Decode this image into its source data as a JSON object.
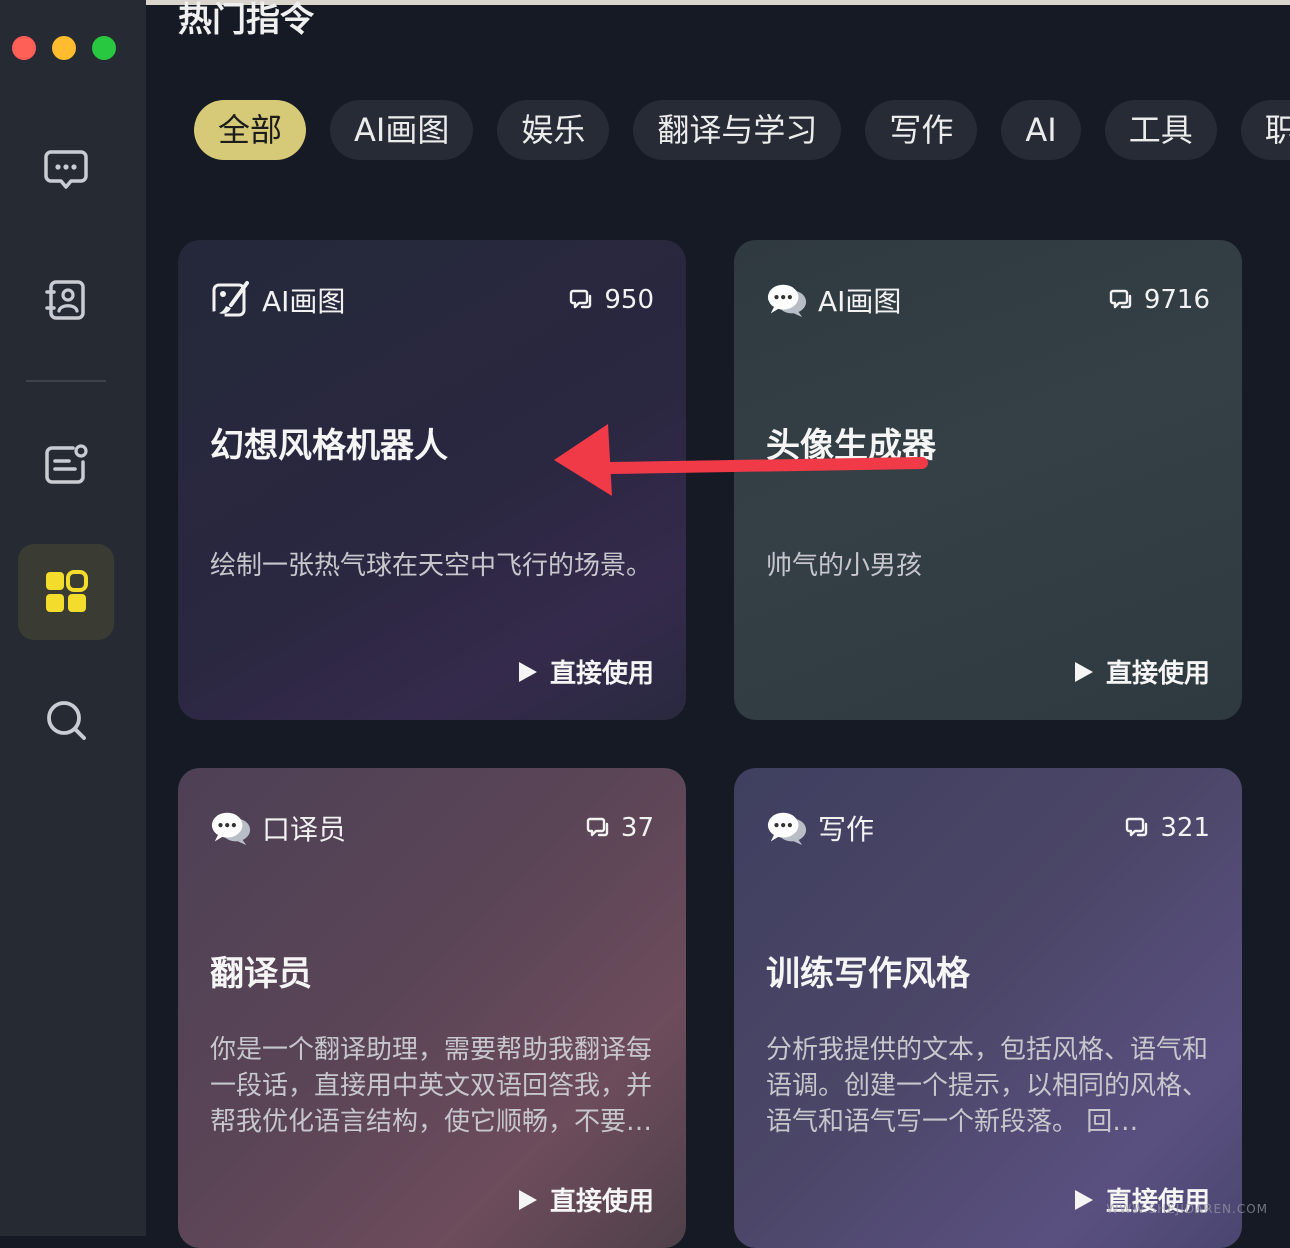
{
  "app": {
    "title": "热门指令",
    "window_controls": [
      "close",
      "minimize",
      "zoom"
    ]
  },
  "sidebar": {
    "items": [
      {
        "id": "chat",
        "icon": "chat-bubble-icon",
        "active": false
      },
      {
        "id": "contacts",
        "icon": "contact-card-icon",
        "active": false
      },
      {
        "id": "notes",
        "icon": "note-edit-icon",
        "active": false
      },
      {
        "id": "apps",
        "icon": "grid-apps-icon",
        "active": true
      },
      {
        "id": "search",
        "icon": "search-icon",
        "active": false
      }
    ]
  },
  "tabs": [
    {
      "label": "全部",
      "active": true
    },
    {
      "label": "AI画图",
      "active": false
    },
    {
      "label": "娱乐",
      "active": false
    },
    {
      "label": "翻译与学习",
      "active": false
    },
    {
      "label": "写作",
      "active": false
    },
    {
      "label": "AI",
      "active": false
    },
    {
      "label": "工具",
      "active": false
    },
    {
      "label": "职",
      "active": false
    }
  ],
  "cards": [
    {
      "category": "AI画图",
      "category_icon": "paint-brush-icon",
      "count": "950",
      "title": "幻想风格机器人",
      "description": "绘制一张热气球在天空中飞行的场景。",
      "action": "直接使用"
    },
    {
      "category": "AI画图",
      "category_icon": "chat-bubbles-icon",
      "count": "9716",
      "title": "头像生成器",
      "description": "帅气的小男孩",
      "action": "直接使用"
    },
    {
      "category": "口译员",
      "category_icon": "chat-bubbles-icon",
      "count": "37",
      "title": "翻译员",
      "description": "你是一个翻译助理，需要帮助我翻译每一段话，直接用中英文双语回答我，并帮我优化语言结构，使它顺畅，不要…",
      "action": "直接使用"
    },
    {
      "category": "写作",
      "category_icon": "chat-bubbles-icon",
      "count": "321",
      "title": "训练写作风格",
      "description": "分析我提供的文本，包括风格、语气和语调。创建一个提示，以相同的风格、语气和语气写一个新段落。 回…",
      "action": "直接使用"
    }
  ],
  "colors": {
    "background": "#151a24",
    "sidebar": "#262b33",
    "accent": "#d6c977",
    "active_icon": "#f3dc2b",
    "arrow": "#f03a48"
  },
  "watermark": "WWW.SHEJIDAREN.COM"
}
